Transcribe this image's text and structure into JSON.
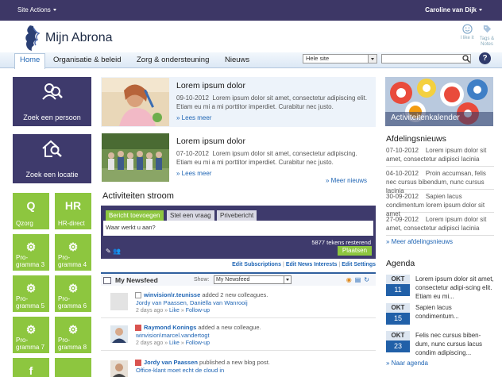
{
  "topbar": {
    "site_actions": "Site Actions",
    "user": "Caroline van Dijk"
  },
  "header": {
    "logo": "Mijn Abrona",
    "like_label": "I like it",
    "tags_label": "Tags & Notes"
  },
  "nav": {
    "items": [
      "Home",
      "Organisatie & beleid",
      "Zorg & ondersteuning",
      "Nieuws"
    ],
    "search_scope": "Hele site",
    "search_value": ""
  },
  "tiles": {
    "person": "Zoek een persoon",
    "location": "Zoek een locatie",
    "small": [
      {
        "glyph": "Q",
        "label": "Qzorg"
      },
      {
        "glyph": "HR",
        "label": "HR-direct"
      },
      {
        "glyph": "⚙",
        "label": "Pro-\ngramma 3"
      },
      {
        "glyph": "⚙",
        "label": "Pro-\ngramma 4"
      },
      {
        "glyph": "⚙",
        "label": "Pro-\ngramma 5"
      },
      {
        "glyph": "⚙",
        "label": "Pro-\ngramma 6"
      },
      {
        "glyph": "⚙",
        "label": "Pro-\ngramma 7"
      },
      {
        "glyph": "⚙",
        "label": "Pro-\ngramma 8"
      },
      {
        "glyph": "f",
        "label": ""
      },
      {
        "glyph": "",
        "label": ""
      }
    ]
  },
  "news": [
    {
      "title": "Lorem ipsum dolor",
      "date": "09-10-2012",
      "text": "Lorem ipsum dolor sit amet, consectetur adipiscing elit. Etiam eu mi a mi porttitor imperdiet. Curabitur nec justo.",
      "more": "» Lees meer"
    },
    {
      "title": "Lorem ipsum dolor",
      "date": "07-10-2012",
      "text": "Lorem ipsum dolor sit amet, consectetur adipiscing. Etiam eu mi a mi porttitor imperdiet. Curabitur nec justo.",
      "more": "» Lees meer"
    }
  ],
  "more_news": "» Meer nieuws",
  "activity": {
    "title": "Activiteiten stroom",
    "tabs": [
      "Bericht toevoegen",
      "Stel een vraag",
      "Privebericht"
    ],
    "placeholder": "Waar werkt u aan?",
    "counter": "5877 tekens resterend",
    "post": "Plaatsen",
    "links": [
      "Edit Subscriptions",
      "Edit News Interests",
      "Edit Settings"
    ]
  },
  "newsfeed": {
    "title": "My Newsfeed",
    "show_label": "Show:",
    "filter": "My Newsfeed",
    "items": [
      {
        "actor": "winvision\\r.teunisse",
        "action": " added 2 new colleagues.",
        "detail": "Jordy van Paassen, Daniëlla van Wanrooij",
        "time": "2 days ago",
        "like": "Like",
        "follow": "Follow-up"
      },
      {
        "actor": "Raymond Konings",
        "action": " added a new colleague.",
        "detail": "winvision\\marcel.vandertogt",
        "time": "2 days ago",
        "like": "Like",
        "follow": "Follow-up"
      },
      {
        "actor": "Jordy van Paassen",
        "action": " published a new blog post.",
        "detail": "Office-klant moet echt de cloud in",
        "time": "",
        "like": "",
        "follow": ""
      }
    ]
  },
  "right": {
    "calendar_label": "Activiteitenkalender",
    "dept_title": "Afdelingsnieuws",
    "dept_news": [
      {
        "date": "07-10-2012",
        "text": "Lorem ipsum dolor sit amet, consectetur adipisci lacinia"
      },
      {
        "date": "04-10-2012",
        "text": "Proin accumsan, felis nec cursus bibendum, nunc cursus lacinia"
      },
      {
        "date": "30-09-2012",
        "text": "Sapien lacus condimentum lorem ipsum dolor sit amet"
      },
      {
        "date": "27-09-2012",
        "text": "Lorem ipsum dolor sit amet, consectetur adipisci lacinia"
      }
    ],
    "dept_more": "» Meer afdelingsnieuws",
    "agenda_title": "Agenda",
    "agenda": [
      {
        "month": "OKT",
        "day": "11",
        "text": "Lorem ipsum dolor sit amet, consectetur adipi-scing elit. Etiam eu mi..."
      },
      {
        "month": "OKT",
        "day": "15",
        "text": "Sapien lacus condimentum..."
      },
      {
        "month": "OKT",
        "day": "23",
        "text": "Felis nec cursus biben-dum, nunc cursus lacus condim adipiscing..."
      }
    ],
    "agenda_more": "» Naar agenda"
  },
  "colors": {
    "primary": "#3e3a6c",
    "accent_green": "#8dc63f",
    "link": "#1f65b4"
  }
}
